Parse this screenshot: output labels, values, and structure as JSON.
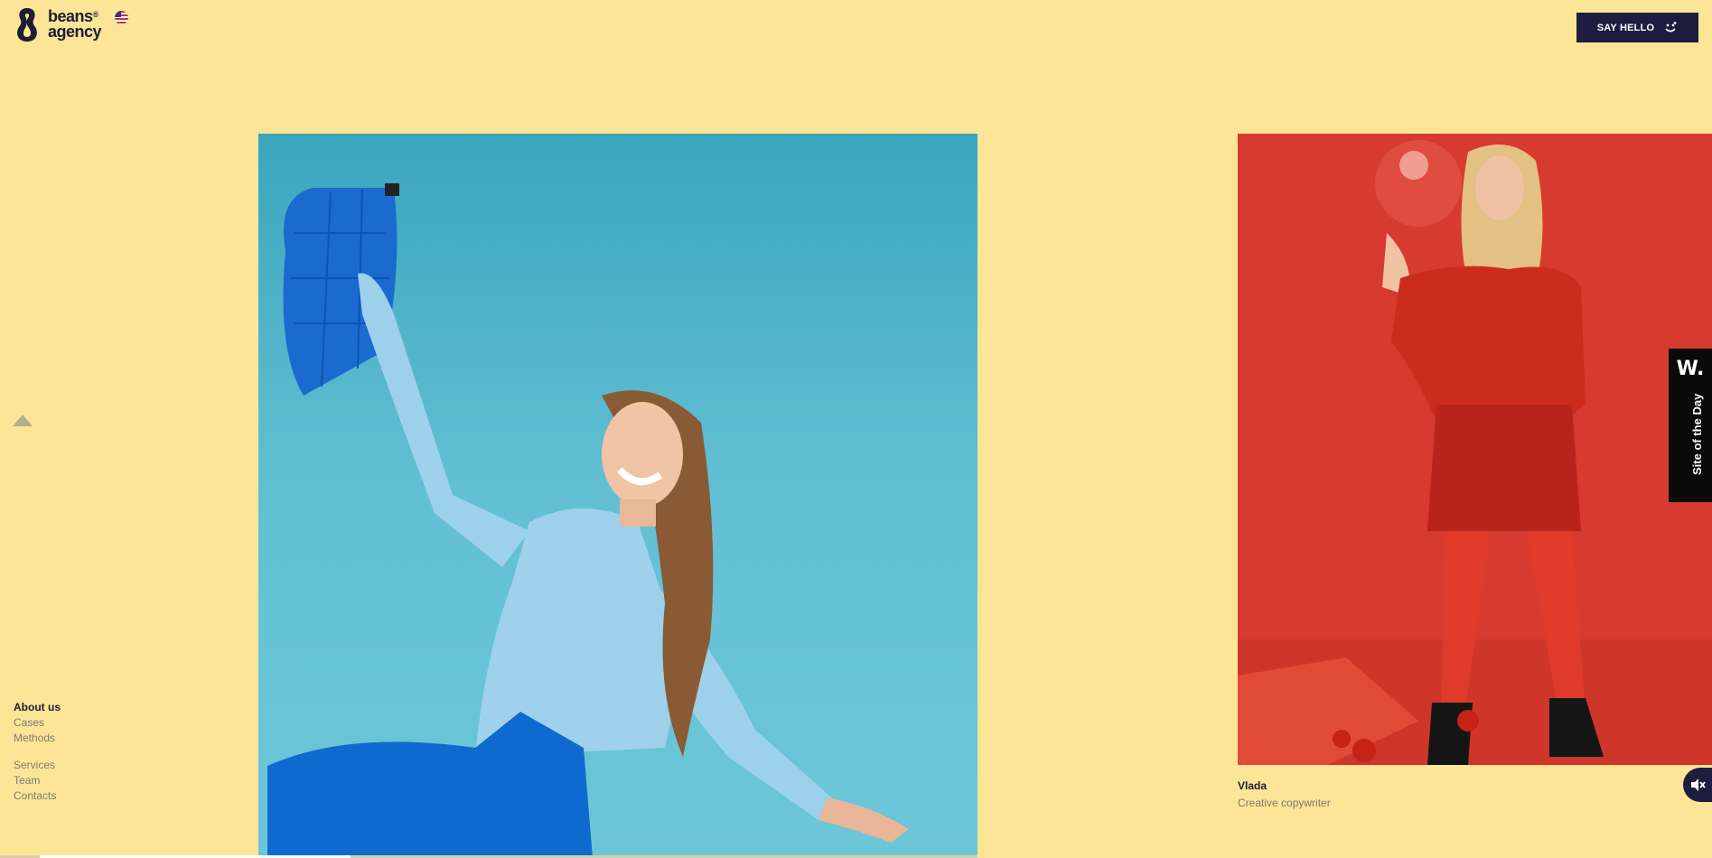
{
  "logo": {
    "line1": "beans",
    "mark": "®",
    "line2": "agency",
    "flag": "us-flag-icon"
  },
  "header": {
    "cta_label": "SAY HELLO",
    "cta_icon": "smile-icon"
  },
  "nav": {
    "items": [
      "About us",
      "Cases",
      "Methods"
    ],
    "items2": [
      "Services",
      "Team",
      "Contacts"
    ],
    "active": "About us"
  },
  "team_member": {
    "name": "Vlada",
    "role": "Creative copywriter"
  },
  "award": {
    "badge": "W.",
    "label": "Site of the Day"
  },
  "colors": {
    "background": "#fce596",
    "dark": "#1d1d3f",
    "blue_photo": "#4cb4cc",
    "red_photo": "#d63a2e"
  }
}
